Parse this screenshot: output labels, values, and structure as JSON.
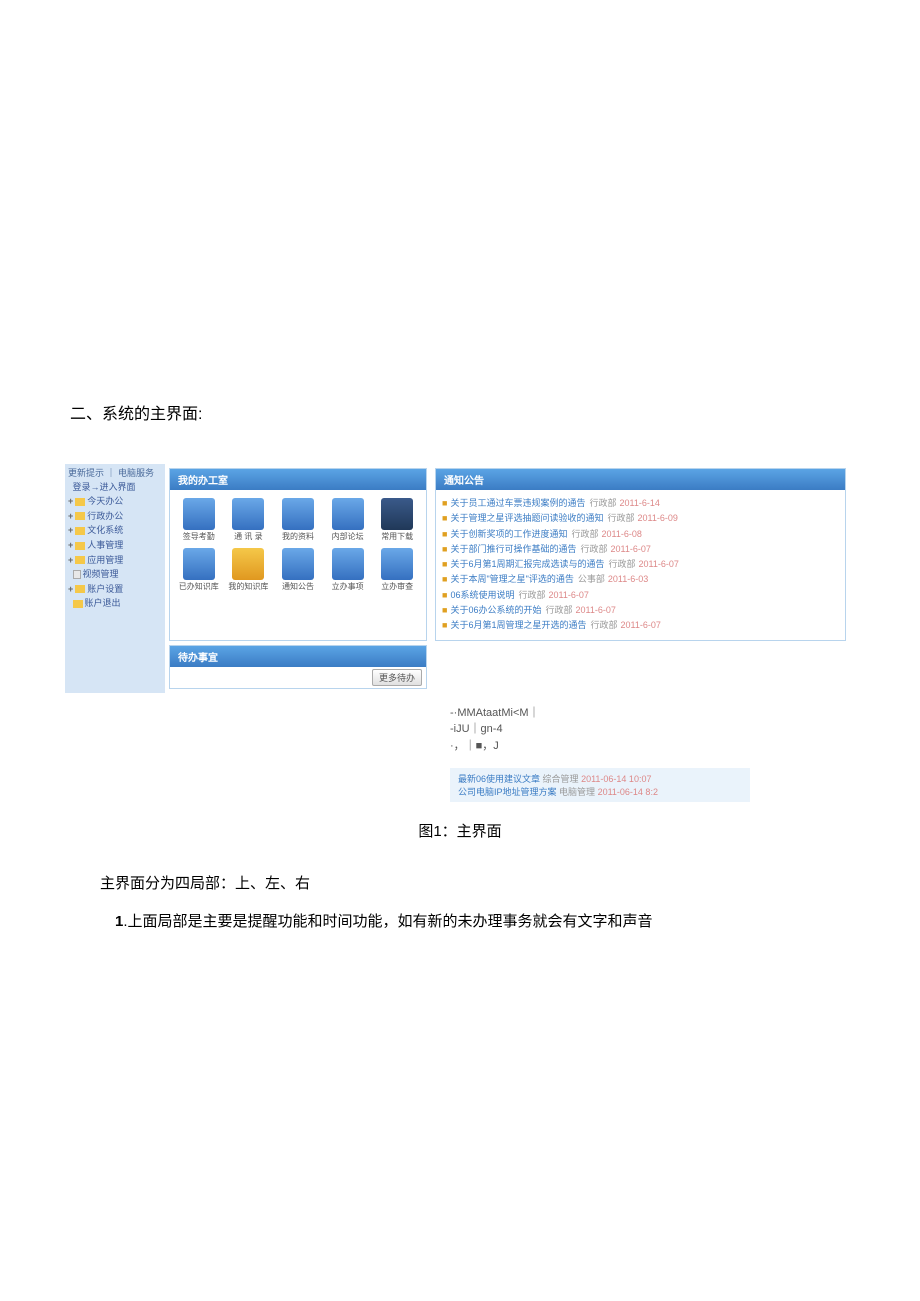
{
  "section_title": "二、系统的主界面:",
  "sidebar": {
    "top_links": "更新提示 ｜ 电脑服务",
    "tree": [
      {
        "icon": "text",
        "label": "登录→进入界面"
      },
      {
        "icon": "folder",
        "plus": true,
        "label": "今天办公"
      },
      {
        "icon": "folder",
        "plus": true,
        "label": "行政办公"
      },
      {
        "icon": "folder",
        "plus": true,
        "label": "文化系统"
      },
      {
        "icon": "folder",
        "plus": true,
        "label": "人事管理"
      },
      {
        "icon": "folder",
        "plus": true,
        "label": "应用管理"
      },
      {
        "icon": "page",
        "plus": false,
        "label": "视频管理"
      },
      {
        "icon": "folder",
        "plus": true,
        "label": "账户设置"
      },
      {
        "icon": "folder",
        "plus": false,
        "label": "账户退出"
      }
    ]
  },
  "workspace": {
    "header": "我的办工室",
    "icons": [
      {
        "label": "签导考勤",
        "style": "folder"
      },
      {
        "label": "通 讯 录",
        "style": "folder"
      },
      {
        "label": "我的资料",
        "style": "folder"
      },
      {
        "label": "内部论坛",
        "style": "folder"
      },
      {
        "label": "常用下载",
        "style": "dark"
      },
      {
        "label": "已办知识库",
        "style": "folder"
      },
      {
        "label": "我的知识库",
        "style": "star"
      },
      {
        "label": "通知公告",
        "style": "folder"
      },
      {
        "label": "立办事项",
        "style": "folder"
      },
      {
        "label": "立办审查",
        "style": "folder"
      }
    ]
  },
  "notices": {
    "header": "通知公告",
    "items": [
      {
        "title": "关于员工通过车票违规案例的通告",
        "author": "行政部",
        "date": "2011-6-14"
      },
      {
        "title": "关于管理之星评选抽题问读验收的通知",
        "author": "行政部",
        "date": "2011-6-09"
      },
      {
        "title": "关于创新奖项的工作进度通知",
        "author": "行政部",
        "date": "2011-6-08"
      },
      {
        "title": "关于部门推行可操作基础的通告",
        "author": "行政部",
        "date": "2011-6-07"
      },
      {
        "title": "关于6月第1周期汇报完成选读与的通告",
        "author": "行政部",
        "date": "2011-6-07"
      },
      {
        "title": "关于本周\"管理之星\"评选的通告",
        "author": "公事部",
        "date": "2011-6-03"
      },
      {
        "title": "06系统使用说明",
        "author": "行政部",
        "date": "2011-6-07"
      },
      {
        "title": "关于06办公系统的开始",
        "author": "行政部",
        "date": "2011-6-07"
      },
      {
        "title": "关于6月第1周管理之星开选的通告",
        "author": "行政部",
        "date": "2011-6-07"
      }
    ]
  },
  "pending": {
    "header": "待办事宜",
    "more_btn": "更多待办"
  },
  "stray": {
    "line1": "-·MMAtaatMi<M｜",
    "line2": "-iJU｜gn-4",
    "line3": "·，｜■，J",
    "list": [
      {
        "title": "最新06使用建议文章",
        "author": "综合管理",
        "date": "2011-06-14 10:07"
      },
      {
        "title": "公司电脑IP地址管理方案",
        "author": "电脑管理",
        "date": "2011-06-14 8:2"
      }
    ]
  },
  "figure_caption": "图1：主界面",
  "body1": "主界面分为四局部：上、左、右",
  "body2_num": "1",
  "body2": ".上面局部是主要是提醒功能和时间功能，如有新的未办理事务就会有文字和声音"
}
